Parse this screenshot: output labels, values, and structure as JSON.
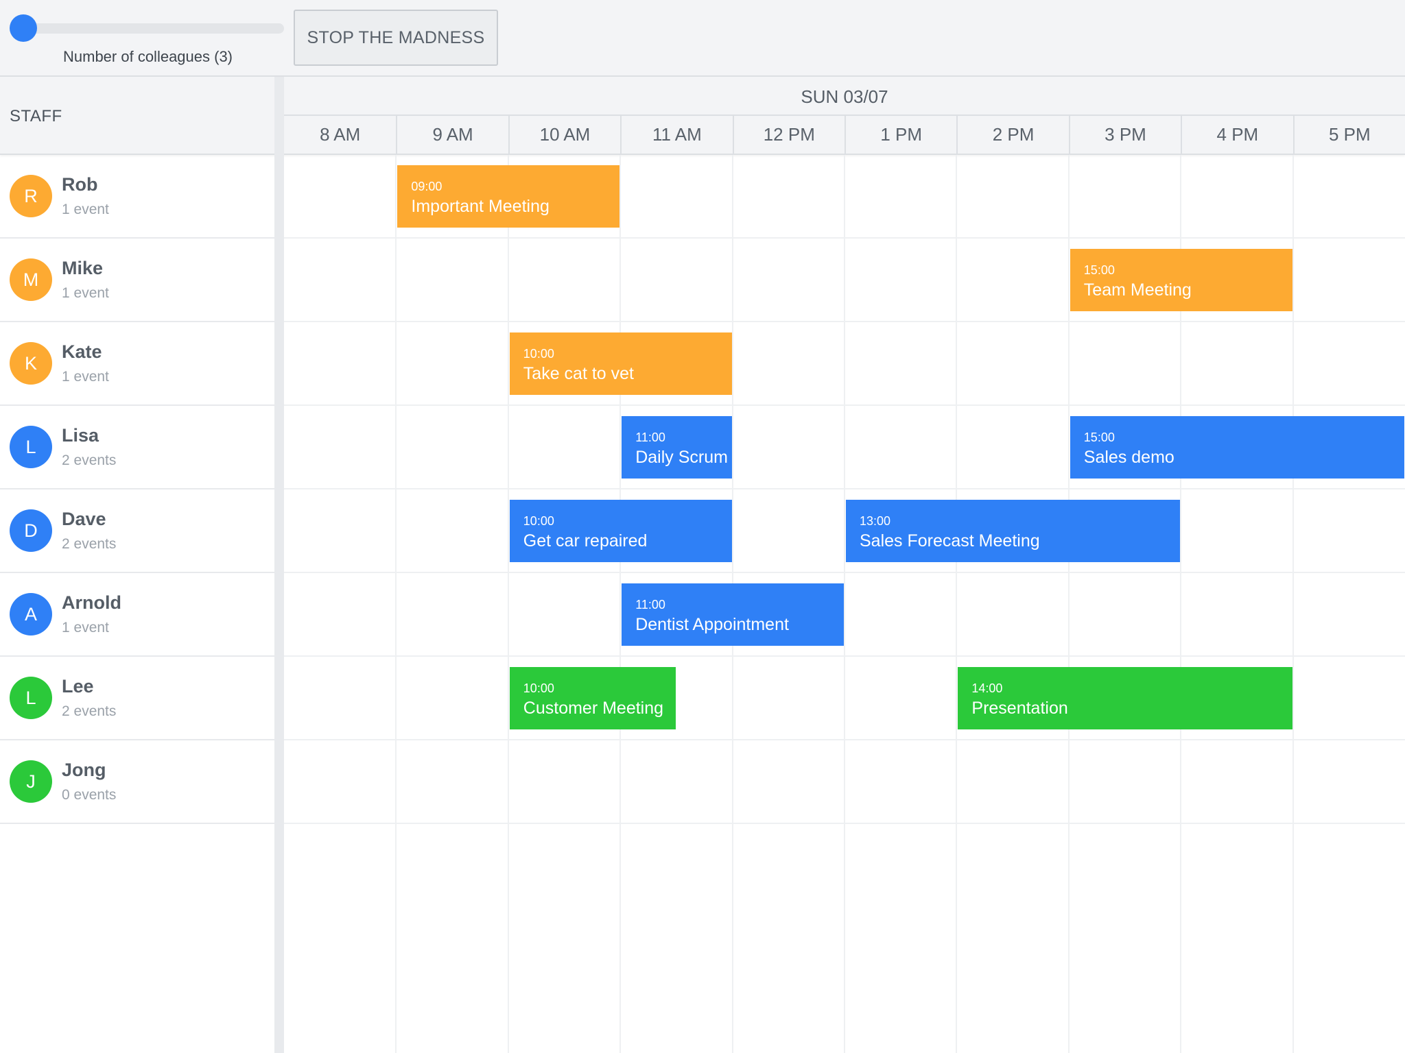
{
  "toolbar": {
    "slider_label": "Number of colleagues (3)",
    "slider_value": 0,
    "button_label": "STOP THE MADNESS"
  },
  "header": {
    "staff_title": "STAFF",
    "date": "SUN 03/07",
    "hours": [
      "8 AM",
      "9 AM",
      "10 AM",
      "11 AM",
      "12 PM",
      "1 PM",
      "2 PM",
      "3 PM",
      "4 PM",
      "5 PM"
    ]
  },
  "colors": {
    "orange": "#fdaa32",
    "blue": "#2f80f6",
    "green": "#2bc93a"
  },
  "staff": [
    {
      "initial": "R",
      "name": "Rob",
      "count": "1 event",
      "color": "orange"
    },
    {
      "initial": "M",
      "name": "Mike",
      "count": "1 event",
      "color": "orange"
    },
    {
      "initial": "K",
      "name": "Kate",
      "count": "1 event",
      "color": "orange"
    },
    {
      "initial": "L",
      "name": "Lisa",
      "count": "2 events",
      "color": "blue"
    },
    {
      "initial": "D",
      "name": "Dave",
      "count": "2 events",
      "color": "blue"
    },
    {
      "initial": "A",
      "name": "Arnold",
      "count": "1 event",
      "color": "blue"
    },
    {
      "initial": "L",
      "name": "Lee",
      "count": "2 events",
      "color": "green"
    },
    {
      "initial": "J",
      "name": "Jong",
      "count": "0 events",
      "color": "green"
    }
  ],
  "events": [
    {
      "staff": 0,
      "start": "09:00",
      "title": "Important Meeting",
      "color": "orange"
    },
    {
      "staff": 1,
      "start": "15:00",
      "title": "Team Meeting",
      "color": "orange"
    },
    {
      "staff": 2,
      "start": "10:00",
      "title": "Take cat to vet",
      "color": "orange"
    },
    {
      "staff": 3,
      "start": "11:00",
      "title": "Daily Scrum",
      "color": "blue"
    },
    {
      "staff": 3,
      "start": "15:00",
      "title": "Sales demo",
      "color": "blue"
    },
    {
      "staff": 4,
      "start": "10:00",
      "title": "Get car repaired",
      "color": "blue"
    },
    {
      "staff": 4,
      "start": "13:00",
      "title": "Sales Forecast Meeting",
      "color": "blue"
    },
    {
      "staff": 5,
      "start": "11:00",
      "title": "Dentist Appointment",
      "color": "blue"
    },
    {
      "staff": 6,
      "start": "10:00",
      "title": "Customer Meeting",
      "color": "green"
    },
    {
      "staff": 6,
      "start": "14:00",
      "title": "Presentation",
      "color": "green"
    }
  ]
}
